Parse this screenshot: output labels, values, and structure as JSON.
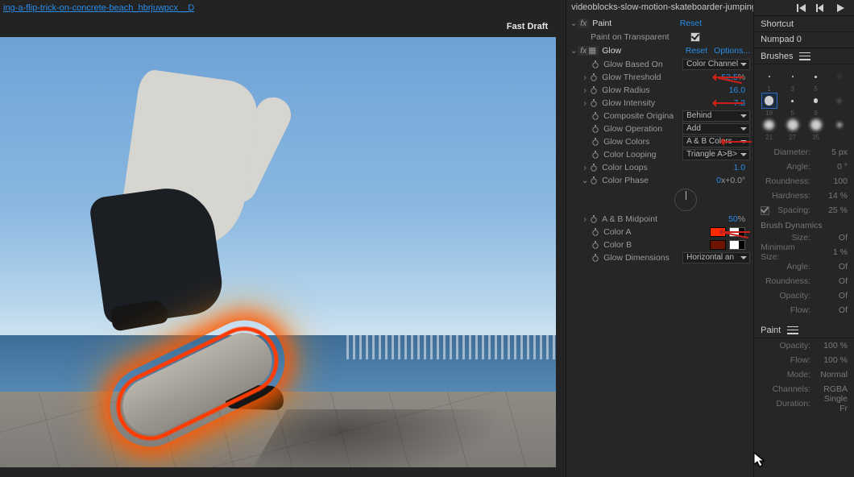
{
  "left": {
    "comp_tab": "ing-a-flip-trick-on-concrete-beach_hbrjuwpcx__D",
    "fast_draft": "Fast Draft"
  },
  "effects_tab": "videoblocks-slow-motion-skateboarder-jumping-and",
  "fx": {
    "paint": {
      "name": "Paint",
      "reset": "Reset",
      "transparent_label": "Paint on Transparent",
      "transparent_checked": true
    },
    "glow": {
      "name": "Glow",
      "reset": "Reset",
      "options": "Options...",
      "props": {
        "based_on": {
          "label": "Glow Based On",
          "value": "Color Channel",
          "type": "select"
        },
        "threshold": {
          "label": "Glow Threshold",
          "value": "52.5",
          "suffix": "%",
          "type": "value"
        },
        "radius": {
          "label": "Glow Radius",
          "value": "16.0",
          "type": "value"
        },
        "intensity": {
          "label": "Glow Intensity",
          "value": "7.3",
          "type": "value"
        },
        "composite": {
          "label": "Composite Origina",
          "value": "Behind",
          "type": "select"
        },
        "operation": {
          "label": "Glow Operation",
          "value": "Add",
          "type": "select"
        },
        "colors": {
          "label": "Glow Colors",
          "value": "A & B Colors",
          "type": "select"
        },
        "looping": {
          "label": "Color Looping",
          "value": "Triangle A>B>",
          "type": "select"
        },
        "loops": {
          "label": "Color Loops",
          "value": "1.0",
          "type": "value"
        },
        "phase": {
          "label": "Color Phase",
          "value": "0",
          "suffix": "x+0.0°",
          "type": "dial"
        },
        "midpoint": {
          "label": "A & B Midpoint",
          "value": "50",
          "suffix": "%",
          "type": "value"
        },
        "colorA": {
          "label": "Color A",
          "value": "#ff2a00",
          "type": "color"
        },
        "colorB": {
          "label": "Color B",
          "value": "#6e1400",
          "type": "color"
        },
        "dimensions": {
          "label": "Glow Dimensions",
          "value": "Horizontal an",
          "type": "select"
        }
      }
    }
  },
  "right": {
    "shortcut_label": "Shortcut",
    "shortcut_value": "Numpad 0",
    "brushes_label": "Brushes",
    "brush_presets": [
      {
        "size": 1,
        "soft": false
      },
      {
        "size": 3,
        "soft": false
      },
      {
        "size": 5,
        "soft": false
      },
      {
        "size": 2,
        "soft": true
      },
      {
        "size": 19,
        "soft": false
      },
      {
        "size": 5,
        "soft": false
      },
      {
        "size": 9,
        "soft": false
      },
      {
        "size": 5,
        "soft": true
      },
      {
        "size": 21,
        "soft": true
      },
      {
        "size": 27,
        "soft": true
      },
      {
        "size": 35,
        "soft": true
      },
      {
        "size": 10,
        "soft": true
      }
    ],
    "brush_labels": [
      "1",
      "3",
      "5",
      "",
      "19",
      "5",
      "9",
      "",
      "21",
      "27",
      "35",
      ""
    ],
    "brush_tip": {
      "diameter": {
        "k": "Diameter:",
        "v": "5 px"
      },
      "angle": {
        "k": "Angle:",
        "v": "0 °"
      },
      "roundness": {
        "k": "Roundness:",
        "v": "100"
      },
      "hardness": {
        "k": "Hardness:",
        "v": "14 %"
      },
      "spacing": {
        "k": "Spacing:",
        "v": "25 %",
        "checked": true
      }
    },
    "brush_dyn_label": "Brush Dynamics",
    "brush_dyn": {
      "size": {
        "k": "Size:",
        "v": "Of"
      },
      "minsize": {
        "k": "Minimum Size:",
        "v": "1 %"
      },
      "angle": {
        "k": "Angle:",
        "v": "Of"
      },
      "roundness": {
        "k": "Roundness:",
        "v": "Of"
      },
      "opacity": {
        "k": "Opacity:",
        "v": "Of"
      },
      "flow": {
        "k": "Flow:",
        "v": "Of"
      }
    },
    "paint_label": "Paint",
    "paint": {
      "opacity": {
        "k": "Opacity:",
        "v": "100 %"
      },
      "flow": {
        "k": "Flow:",
        "v": "100 %"
      },
      "mode": {
        "k": "Mode:",
        "v": "Normal"
      },
      "channels": {
        "k": "Channels:",
        "v": "RGBA"
      },
      "duration": {
        "k": "Duration:",
        "v": "Single Fr"
      }
    }
  }
}
